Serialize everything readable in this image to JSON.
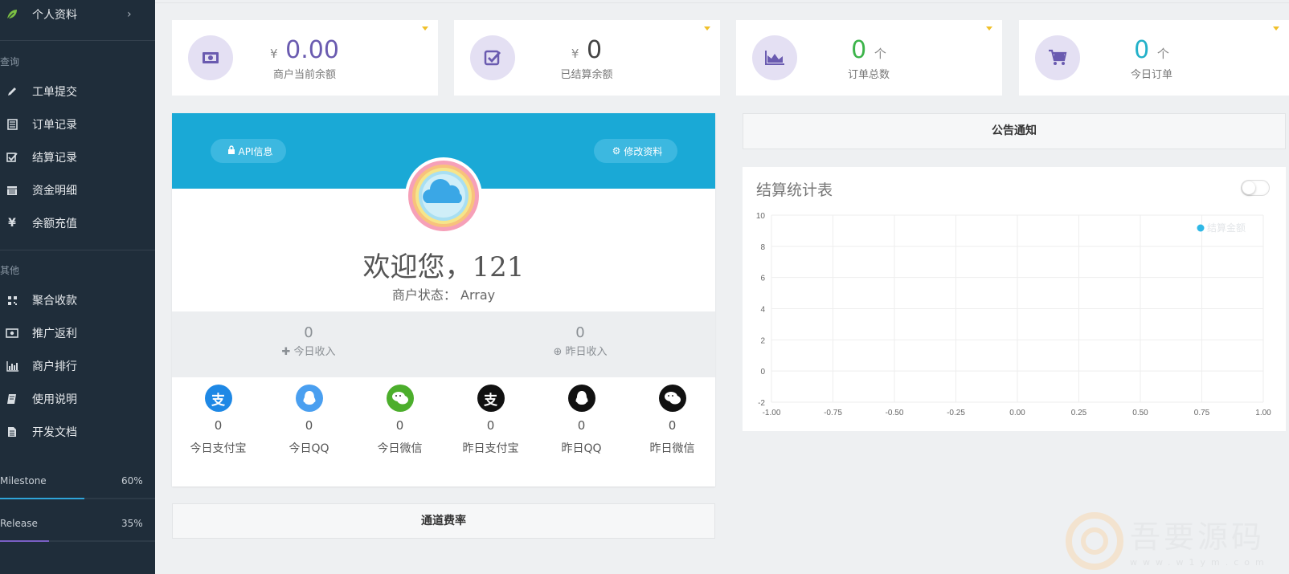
{
  "sidebar": {
    "profile_label": "个人资料",
    "section_query": "查询",
    "section_other": "其他",
    "items_query": [
      {
        "label": "工单提交",
        "icon": "pencil-icon"
      },
      {
        "label": "订单记录",
        "icon": "list-icon"
      },
      {
        "label": "结算记录",
        "icon": "check-square-icon"
      },
      {
        "label": "资金明细",
        "icon": "calendar-icon"
      },
      {
        "label": "余额充值",
        "icon": "yen-icon"
      }
    ],
    "items_other": [
      {
        "label": "聚合收款",
        "icon": "qrcode-icon"
      },
      {
        "label": "推广返利",
        "icon": "money-icon"
      },
      {
        "label": "商户排行",
        "icon": "bar-chart-icon"
      },
      {
        "label": "使用说明",
        "icon": "book-icon"
      },
      {
        "label": "开发文档",
        "icon": "file-icon"
      }
    ],
    "progress": [
      {
        "label": "Milestone",
        "pct": "60%",
        "value": 60,
        "color": "#2fa4d9"
      },
      {
        "label": "Release",
        "pct": "35%",
        "value": 35,
        "color": "#7a5fc4"
      }
    ]
  },
  "stats": [
    {
      "prefix": "¥",
      "value": "0.00",
      "unit": "",
      "caption": "商户当前余额",
      "color": "#6a5bb0",
      "icon": "banknote-icon"
    },
    {
      "prefix": "¥",
      "value": "0",
      "unit": "",
      "caption": "已结算余额",
      "color": "#444444",
      "icon": "checkbox-icon"
    },
    {
      "prefix": "",
      "value": "0",
      "unit": "个",
      "caption": "订单总数",
      "color": "#3cb44a",
      "icon": "area-chart-icon"
    },
    {
      "prefix": "",
      "value": "0",
      "unit": "个",
      "caption": "今日订单",
      "color": "#23b1c9",
      "icon": "cart-icon"
    }
  ],
  "profile": {
    "api_label": "API信息",
    "edit_label": "修改资料",
    "welcome": "欢迎您，121",
    "merchant_status": "商户状态： Array",
    "today_income_value": "0",
    "today_income_label": "今日收入",
    "yesterday_income_value": "0",
    "yesterday_income_label": "昨日收入",
    "payments": [
      {
        "value": "0",
        "label": "今日支付宝",
        "icon": "alipay-icon",
        "bg": "#1e88e5",
        "glyph": "支"
      },
      {
        "value": "0",
        "label": "今日QQ",
        "icon": "qq-icon",
        "bg": "#4a9ff0",
        "glyph": ""
      },
      {
        "value": "0",
        "label": "今日微信",
        "icon": "wechat-icon",
        "bg": "#4cae2c",
        "glyph": ""
      },
      {
        "value": "0",
        "label": "昨日支付宝",
        "icon": "alipay-icon",
        "bg": "#111111",
        "glyph": "支"
      },
      {
        "value": "0",
        "label": "昨日QQ",
        "icon": "qq-icon",
        "bg": "#111111",
        "glyph": ""
      },
      {
        "value": "0",
        "label": "昨日微信",
        "icon": "wechat-icon",
        "bg": "#111111",
        "glyph": ""
      }
    ]
  },
  "rate_title": "通道费率",
  "notice_title": "公告通知",
  "watermark": {
    "text": "吾要源码",
    "url": "www.w1ym.com"
  },
  "chart_data": {
    "type": "line",
    "title": "结算统计表",
    "xlabel": "",
    "ylabel": "",
    "xlim": [
      -1,
      1
    ],
    "ylim": [
      -2,
      10
    ],
    "x_ticks": [
      "-1.00",
      "-0.75",
      "-0.50",
      "-0.25",
      "0.00",
      "0.25",
      "0.50",
      "0.75",
      "1.00"
    ],
    "y_ticks": [
      "10",
      "8",
      "6",
      "4",
      "2",
      "0",
      "-2"
    ],
    "grid": true,
    "legend": "top-right",
    "series": [
      {
        "name": "结算金额",
        "color": "#2fb8e6",
        "values": []
      }
    ]
  }
}
